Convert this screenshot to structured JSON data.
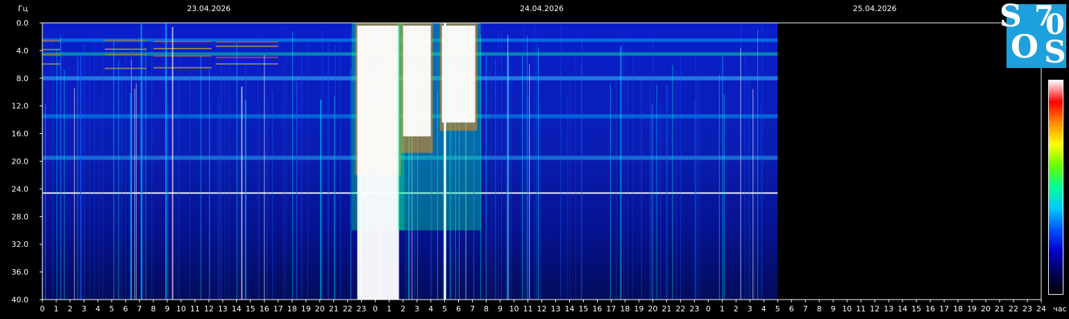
{
  "chart_data": {
    "type": "heatmap",
    "ylabel": "Гц",
    "xlabel": "час",
    "ylim": [
      0,
      40
    ],
    "y_ticks": [
      "0.0",
      "4.0",
      "8.0",
      "12.0",
      "16.0",
      "20.0",
      "24.0",
      "28.0",
      "32.0",
      "36.0",
      "40.0"
    ],
    "x_ticks": [
      "0",
      "1",
      "2",
      "3",
      "4",
      "5",
      "6",
      "7",
      "8",
      "9",
      "10",
      "11",
      "12",
      "13",
      "14",
      "15",
      "16",
      "17",
      "18",
      "19",
      "20",
      "21",
      "22",
      "23",
      "0",
      "1",
      "2",
      "3",
      "4",
      "5",
      "6",
      "7",
      "8",
      "9",
      "10",
      "11",
      "12",
      "13",
      "14",
      "15",
      "16",
      "17",
      "18",
      "19",
      "20",
      "21",
      "22",
      "23",
      "0",
      "1",
      "2",
      "3",
      "4",
      "5",
      "6",
      "7",
      "8",
      "9",
      "10",
      "11",
      "12",
      "13",
      "14",
      "15",
      "16",
      "17",
      "18",
      "19",
      "20",
      "21",
      "22",
      "23",
      "24"
    ],
    "dates": [
      "23.04.2026",
      "24.04.2026",
      "25.04.2026"
    ],
    "xlim_hours": [
      0,
      72
    ],
    "data_end_hour": 53,
    "bands_hz": [
      2.5,
      4.5,
      8.0,
      13.5,
      19.5,
      24.6
    ],
    "storm_hours": [
      [
        22.7,
        25.7
      ],
      [
        26.0,
        28.0
      ],
      [
        28.8,
        31.2
      ]
    ],
    "colormap": [
      "#000000",
      "#00005a",
      "#0000c8",
      "#0050ff",
      "#00c8ff",
      "#00ff96",
      "#64ff00",
      "#ffff00",
      "#ff8c00",
      "#ff0000",
      "#ffffff"
    ]
  },
  "logo": {
    "text1": "S",
    "text2": "7",
    "text3": "0",
    "text4": "O",
    "text5": "S"
  }
}
